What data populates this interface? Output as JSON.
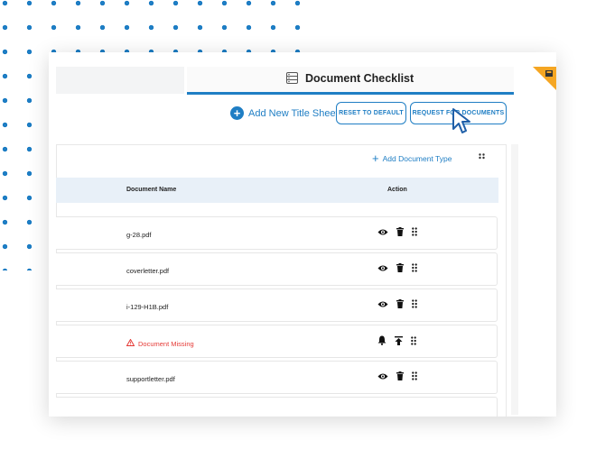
{
  "tab": {
    "title": "Document Checklist",
    "icon": "server-list-icon",
    "badge_icon": "printer-icon"
  },
  "toolbar": {
    "add_title_sheet": "Add New Title Sheet",
    "reset_label": "RESET TO DEFAULT",
    "request_label": "REQUEST FOR DOCUMENTS"
  },
  "panel": {
    "add_document_type": "Add Document Type",
    "columns": {
      "name": "Document Name",
      "action": "Action"
    }
  },
  "documents": [
    {
      "name": "g-28.pdf",
      "missing": false
    },
    {
      "name": "coverletter.pdf",
      "missing": false
    },
    {
      "name": "i-129-H1B.pdf",
      "missing": false
    },
    {
      "name": "Document Missing",
      "missing": true
    },
    {
      "name": "supportletter.pdf",
      "missing": false
    }
  ],
  "colors": {
    "accent": "#1f7ec4",
    "badge": "#f5a623",
    "missing": "#e53935"
  }
}
